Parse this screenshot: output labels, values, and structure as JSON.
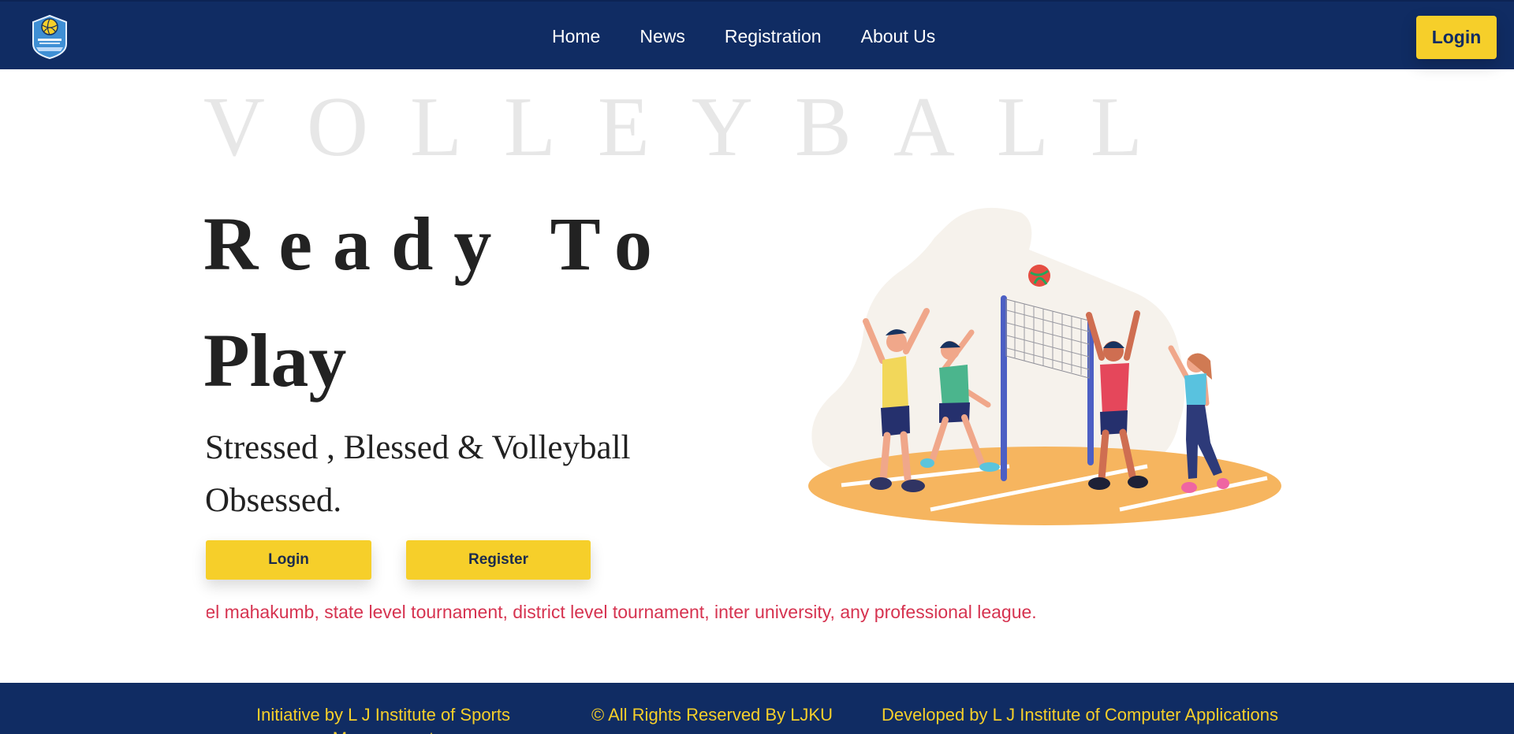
{
  "navbar": {
    "links": [
      {
        "label": "Home"
      },
      {
        "label": "News"
      },
      {
        "label": "Registration"
      },
      {
        "label": "About Us"
      }
    ],
    "login_label": "Login"
  },
  "hero": {
    "watermark": "VOLLEYBALL",
    "line1": "Ready To",
    "line2": "Play",
    "tagline": "Stressed , Blessed & Volleyball Obsessed.",
    "login_button": "Login",
    "register_button": "Register",
    "marquee": "ıel mahakumb, state level tournament, district level tournament, inter university, any professional league."
  },
  "footer": {
    "initiative": "Initiative by L J Institute of Sports Management",
    "rights": "© All Rights Reserved By LJKU",
    "developed": "Developed by L J Institute of Computer Applications"
  },
  "colors": {
    "navy": "#102c63",
    "accent": "#f6cf2a",
    "marquee": "#d63350"
  }
}
